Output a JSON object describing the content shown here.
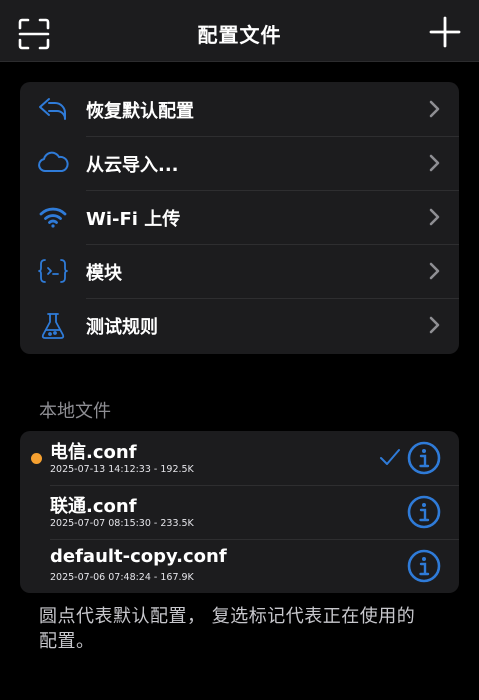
{
  "nav": {
    "title": "配置文件",
    "left_icon": "scan-icon",
    "right_icon": "plus-icon"
  },
  "menu": {
    "items": [
      {
        "label": "恢复默认配置",
        "icon": "undo-arrow-icon"
      },
      {
        "label": "从云导入...",
        "icon": "cloud-icon"
      },
      {
        "label": "Wi-Fi 上传",
        "icon": "wifi-icon"
      },
      {
        "label": "模块",
        "icon": "module-braces-icon"
      },
      {
        "label": "测试规则",
        "icon": "flask-icon"
      }
    ]
  },
  "local_files": {
    "header": "本地文件",
    "files": [
      {
        "name": "电信.conf",
        "meta": "2025-07-13 14:12:33 - 192.5K",
        "is_default": true,
        "is_selected": true
      },
      {
        "name": "联通.conf",
        "meta": "2025-07-07 08:15:30 - 233.5K",
        "is_default": false,
        "is_selected": false
      },
      {
        "name": "default-copy.conf",
        "meta": "2025-07-06 07:48:24 - 167.9K",
        "is_default": false,
        "is_selected": false
      }
    ]
  },
  "footer": {
    "note": "圆点代表默认配置， 复选标记代表正在使用的配置。"
  },
  "colors": {
    "accent": "#2f7bd8",
    "default_dot": "#f5a030",
    "card_bg": "#1c1c1e",
    "chevron": "#8e8e93"
  }
}
